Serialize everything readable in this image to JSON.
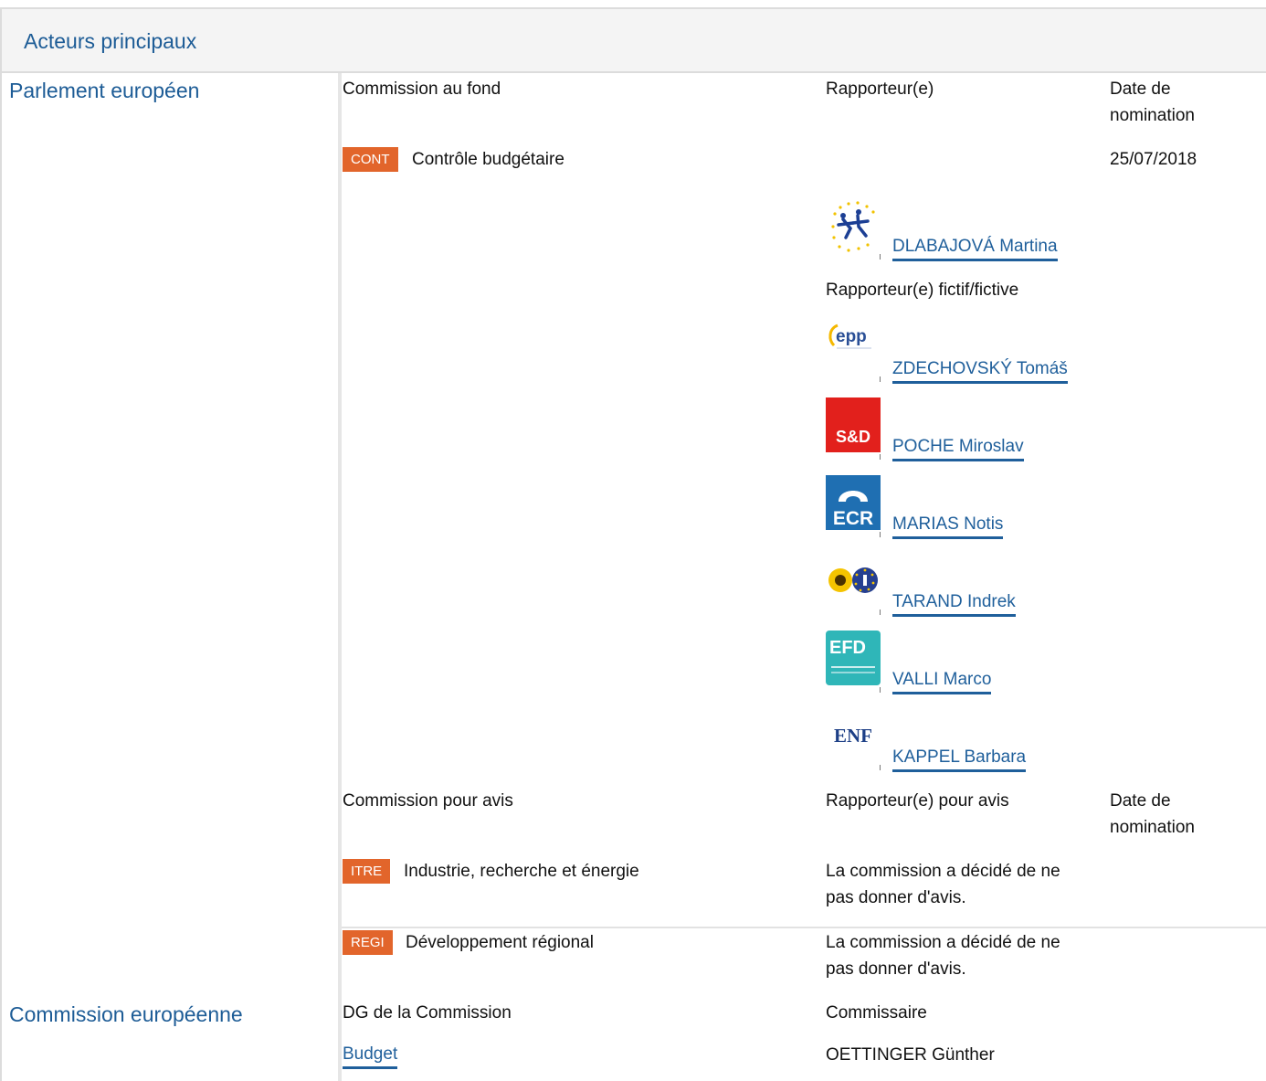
{
  "section": {
    "title": "Acteurs principaux"
  },
  "parliament": {
    "name": "Parlement européen",
    "lead": {
      "col_committee": "Commission au fond",
      "col_rapporteur": "Rapporteur(e)",
      "col_date": "Date de\nnomination",
      "committee_code": "CONT",
      "committee_name": "Contrôle budgétaire",
      "date": "25/07/2018",
      "rapporteurs": [
        {
          "name": "DLABAJOVÁ Martina",
          "group_logo": "renew-europe-logo-icon"
        }
      ],
      "shadow_label": "Rapporteur(e) fictif/fictive",
      "shadows": [
        {
          "name": "ZDECHOVSKÝ Tomáš",
          "group_logo": "epp-logo-icon",
          "logo_text": "epp"
        },
        {
          "name": "POCHE Miroslav",
          "group_logo": "sd-logo-icon",
          "logo_text": "S&D"
        },
        {
          "name": "MARIAS Notis",
          "group_logo": "ecr-logo-icon",
          "logo_text": "ECR"
        },
        {
          "name": "TARAND Indrek",
          "group_logo": "greens-efa-logo-icon"
        },
        {
          "name": "VALLI Marco",
          "group_logo": "efdd-logo-icon",
          "logo_text": "EFD"
        },
        {
          "name": "KAPPEL Barbara",
          "group_logo": "enf-logo-icon",
          "logo_text": "ENF"
        }
      ]
    },
    "opinion": {
      "col_committee": "Commission pour avis",
      "col_rapporteur": "Rapporteur(e) pour avis",
      "col_date": "Date de\nnomination",
      "rows": [
        {
          "code": "ITRE",
          "name": "Industrie, recherche et énergie",
          "status": "La commission a décidé de ne\npas donner d'avis."
        },
        {
          "code": "REGI",
          "name": "Développement régional",
          "status": "La commission a décidé de ne\npas donner d'avis."
        }
      ]
    }
  },
  "commission": {
    "name": "Commission européenne",
    "col_dg": "DG de la Commission",
    "col_commissioner": "Commissaire",
    "dg": "Budget",
    "commissioner": "OETTINGER Günther"
  },
  "colors": {
    "accent": "#1d5c96",
    "badge": "#e2652b"
  }
}
